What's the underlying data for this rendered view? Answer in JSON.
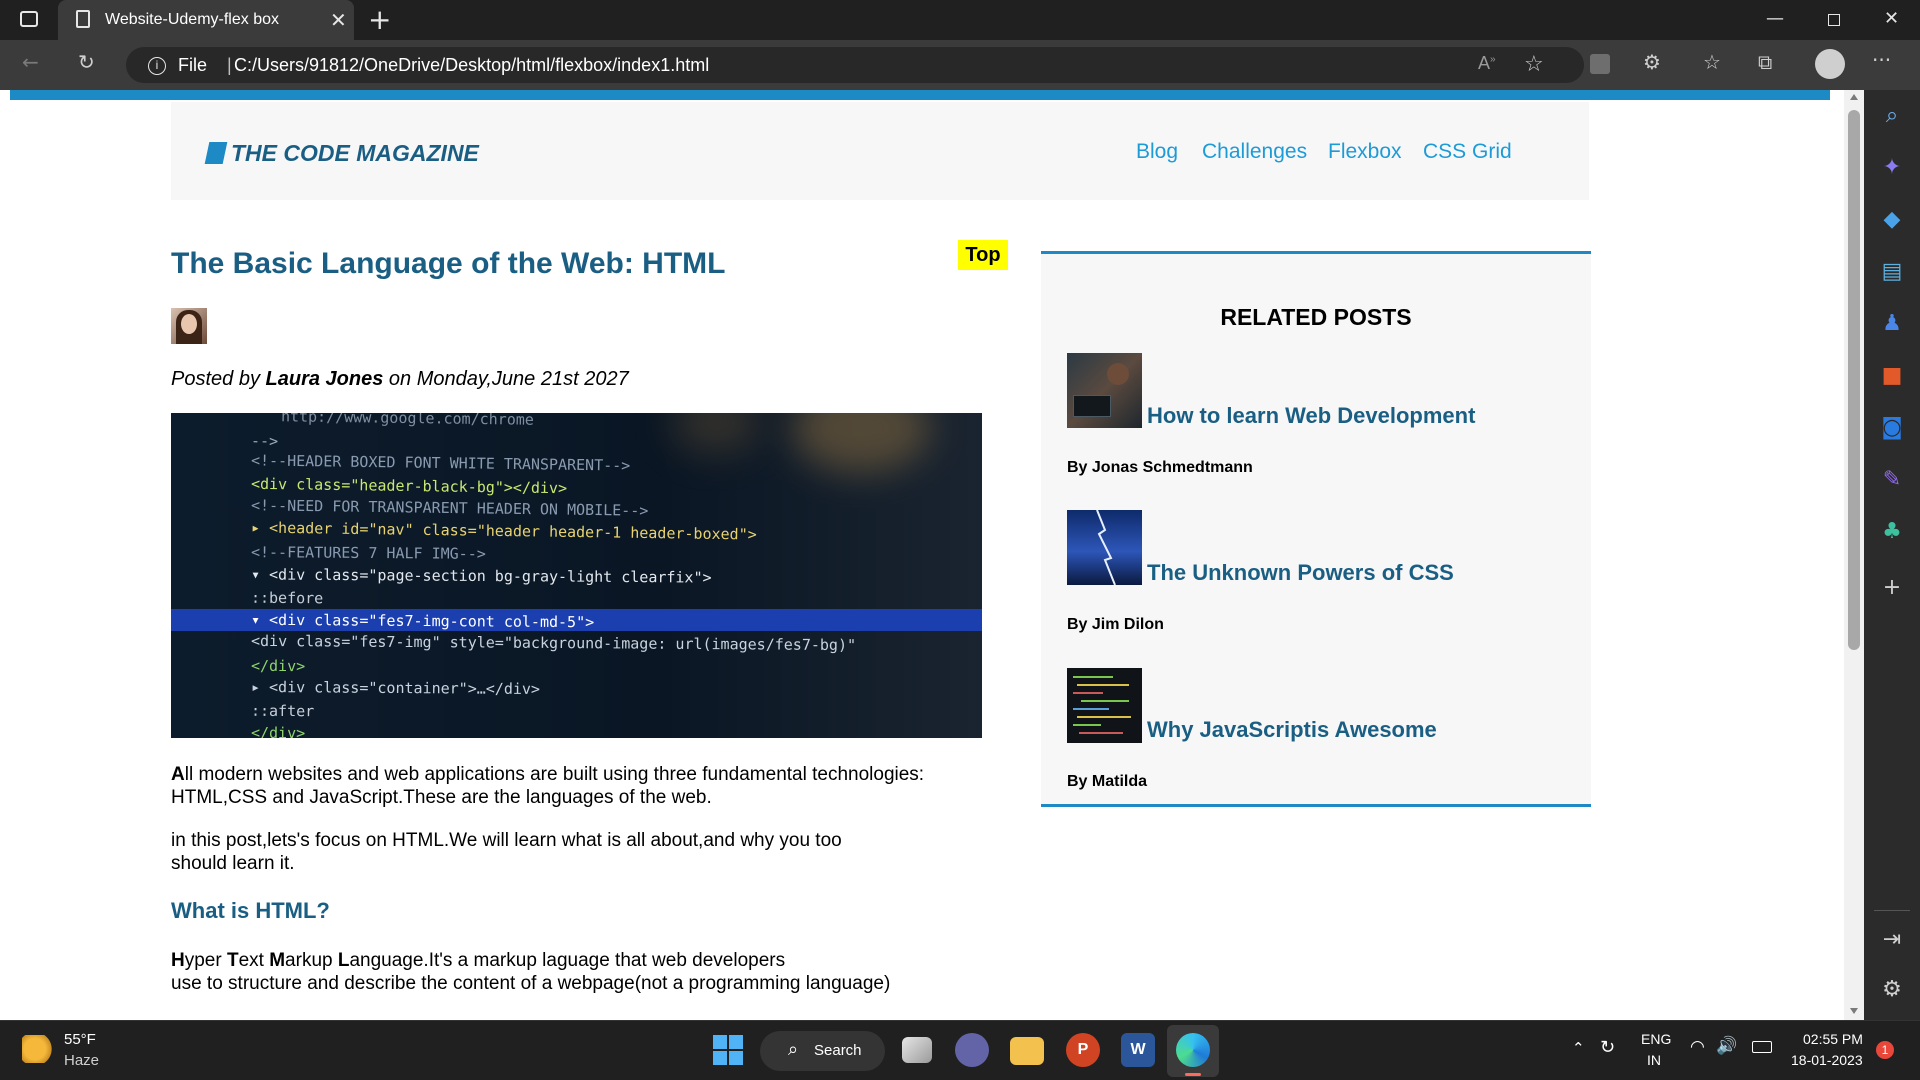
{
  "browser": {
    "tab_title": "Website-Udemy-flex box",
    "address_prefix": "File",
    "address_sep": "|",
    "url": "C:/Users/91812/OneDrive/Desktop/html/flexbox/index1.html"
  },
  "site": {
    "logo": "THE CODE MAGAZINE",
    "nav": [
      "Blog",
      "Challenges",
      "Flexbox",
      "CSS Grid"
    ]
  },
  "article": {
    "title": "The Basic Language of the Web: HTML",
    "top_badge": "Top",
    "posted_prefix": "Posted by ",
    "author": "Laura Jones",
    "posted_suffix": " on Monday,June 21st 2027",
    "p1_first": "A",
    "p1_rest": "ll modern websites and web applications are built using three fundamental technologies:",
    "p1_line2": "HTML,CSS and JavaScript.These are the languages of the web.",
    "p2_line1": "in this post,lets's focus on HTML.We will learn what is all about,and why you too",
    "p2_line2": "should learn it.",
    "subhead": "What is HTML?",
    "p3_H": "H",
    "p3_yper": "yper ",
    "p3_T": "T",
    "p3_ext": "ext ",
    "p3_M": "M",
    "p3_arkup": "arkup ",
    "p3_L": "L",
    "p3_rest": "anguage.It's a markup laguage that web developers",
    "p3_line2": "use to structure and describe the content of a webpage(not a programming language)"
  },
  "hero_code": [
    "    http://www.google.com/chrome",
    "  -->",
    "  <!--HEADER BOXED FONT WHITE TRANSPARENT-->",
    "  <div class=\"header-black-bg\"></div>",
    "  <!--NEED FOR TRANSPARENT HEADER ON MOBILE-->",
    " ▸ <header id=\"nav\" class=\"header header-1 header-boxed\">",
    "  <!--FEATURES 7 HALF IMG-->",
    "▾ <div class=\"page-section bg-gray-light clearfix\">",
    "    ::before",
    "  ▾ <div class=\"fes7-img-cont col-md-5\">",
    "      <div class=\"fes7-img\" style=\"background-image: url(images/fes7-bg)\"",
    "    </div>",
    "  ▸ <div class=\"container\">…</div>",
    "    ::after",
    "  </div>"
  ],
  "related": {
    "title": "RELATED POSTS",
    "posts": [
      {
        "title": "How to learn Web Development",
        "by": "By Jonas Schmedtmann"
      },
      {
        "title": "The Unknown Powers of CSS",
        "by": "By Jim Dilon"
      },
      {
        "title": "Why JavaScriptis Awesome",
        "by": "By Matilda"
      }
    ]
  },
  "taskbar": {
    "weather_temp": "55°F",
    "weather_desc": "Haze",
    "search": "Search",
    "lang1": "ENG",
    "lang2": "IN",
    "time": "02:55 PM",
    "date": "18-01-2023",
    "notif": "1"
  },
  "colors": {
    "accent": "#1d89c5",
    "heading": "#1a5f83",
    "nav_link": "#1d9bd7",
    "badge": "#ffff00"
  }
}
